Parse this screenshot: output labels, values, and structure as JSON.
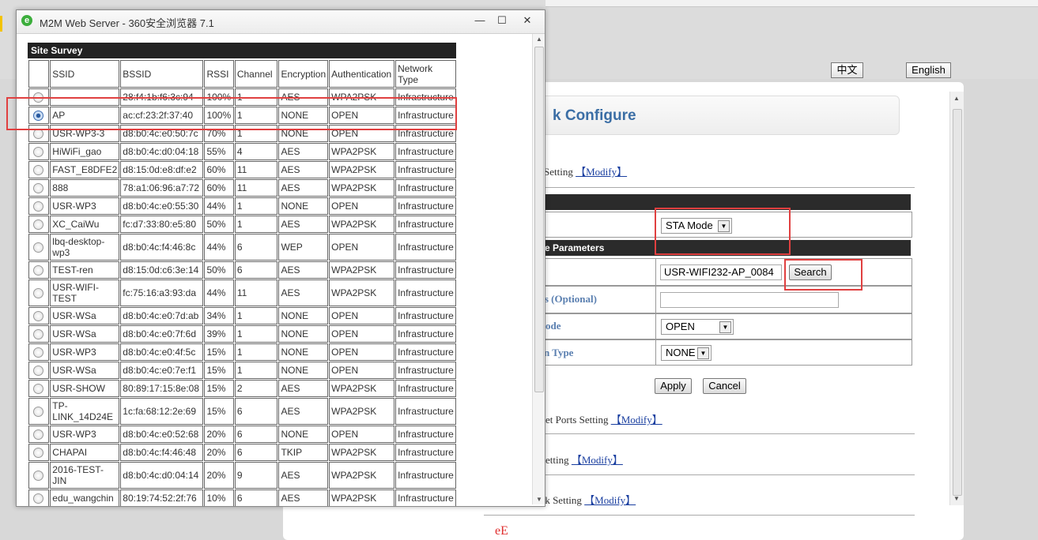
{
  "background_page": {
    "lang_chinese": "中文",
    "lang_english": "English",
    "title": "k Configure",
    "section1_text": "Setting",
    "modify_label": "【Modify】",
    "bar1_label": "",
    "mode_select": "STA Mode",
    "bar2_label": "e Parameters",
    "ssid_value": "USR-WIFI232-AP_0084",
    "search_button": "Search",
    "mac_label": "ess (Optional)",
    "mac_value": "",
    "auth_label": "ode",
    "auth_value": "OPEN",
    "enc_label": "n Type",
    "enc_value": "NONE",
    "apply_button": "Apply",
    "cancel_button": "Cancel",
    "ports_text": "et Ports Setting",
    "setting_text": "etting",
    "network_text": "rk Setting",
    "stray_char": "eE"
  },
  "popup": {
    "window_title": "M2M Web Server - 360安全浏览器 7.1",
    "minimize": "—",
    "maximize": "☐",
    "close": "✕",
    "survey_title": "Site Survey",
    "columns": [
      "",
      "SSID",
      "BSSID",
      "RSSI",
      "Channel",
      "Encryption",
      "Authentication",
      "Network Type"
    ],
    "rows": [
      {
        "selected": false,
        "ssid": "",
        "bssid": "28:f4:1b:f6:3c:94",
        "rssi": "100%",
        "channel": "1",
        "encryption": "AES",
        "auth": "WPA2PSK",
        "type": "Infrastructure"
      },
      {
        "selected": true,
        "ssid": "AP",
        "bssid": "ac:cf:23:2f:37:40",
        "rssi": "100%",
        "channel": "1",
        "encryption": "NONE",
        "auth": "OPEN",
        "type": "Infrastructure"
      },
      {
        "selected": false,
        "ssid": "USR-WP3-3",
        "bssid": "d8:b0:4c:e0:50:7c",
        "rssi": "70%",
        "channel": "1",
        "encryption": "NONE",
        "auth": "OPEN",
        "type": "Infrastructure"
      },
      {
        "selected": false,
        "ssid": "HiWiFi_gao",
        "bssid": "d8:b0:4c:d0:04:18",
        "rssi": "55%",
        "channel": "4",
        "encryption": "AES",
        "auth": "WPA2PSK",
        "type": "Infrastructure"
      },
      {
        "selected": false,
        "ssid": "FAST_E8DFE2",
        "bssid": "d8:15:0d:e8:df:e2",
        "rssi": "60%",
        "channel": "11",
        "encryption": "AES",
        "auth": "WPA2PSK",
        "type": "Infrastructure"
      },
      {
        "selected": false,
        "ssid": "888",
        "bssid": "78:a1:06:96:a7:72",
        "rssi": "60%",
        "channel": "11",
        "encryption": "AES",
        "auth": "WPA2PSK",
        "type": "Infrastructure"
      },
      {
        "selected": false,
        "ssid": "USR-WP3",
        "bssid": "d8:b0:4c:e0:55:30",
        "rssi": "44%",
        "channel": "1",
        "encryption": "NONE",
        "auth": "OPEN",
        "type": "Infrastructure"
      },
      {
        "selected": false,
        "ssid": "XC_CaiWu",
        "bssid": "fc:d7:33:80:e5:80",
        "rssi": "50%",
        "channel": "1",
        "encryption": "AES",
        "auth": "WPA2PSK",
        "type": "Infrastructure"
      },
      {
        "selected": false,
        "ssid": "lbq-desktop-wp3",
        "bssid": "d8:b0:4c:f4:46:8c",
        "rssi": "44%",
        "channel": "6",
        "encryption": "WEP",
        "auth": "OPEN",
        "type": "Infrastructure",
        "tall": true
      },
      {
        "selected": false,
        "ssid": "TEST-ren",
        "bssid": "d8:15:0d:c6:3e:14",
        "rssi": "50%",
        "channel": "6",
        "encryption": "AES",
        "auth": "WPA2PSK",
        "type": "Infrastructure"
      },
      {
        "selected": false,
        "ssid": "USR-WIFI-TEST",
        "bssid": "fc:75:16:a3:93:da",
        "rssi": "44%",
        "channel": "11",
        "encryption": "AES",
        "auth": "WPA2PSK",
        "type": "Infrastructure",
        "tall": true
      },
      {
        "selected": false,
        "ssid": "USR-WSa",
        "bssid": "d8:b0:4c:e0:7d:ab",
        "rssi": "34%",
        "channel": "1",
        "encryption": "NONE",
        "auth": "OPEN",
        "type": "Infrastructure"
      },
      {
        "selected": false,
        "ssid": "USR-WSa",
        "bssid": "d8:b0:4c:e0:7f:6d",
        "rssi": "39%",
        "channel": "1",
        "encryption": "NONE",
        "auth": "OPEN",
        "type": "Infrastructure"
      },
      {
        "selected": false,
        "ssid": "USR-WP3",
        "bssid": "d8:b0:4c:e0:4f:5c",
        "rssi": "15%",
        "channel": "1",
        "encryption": "NONE",
        "auth": "OPEN",
        "type": "Infrastructure"
      },
      {
        "selected": false,
        "ssid": "USR-WSa",
        "bssid": "d8:b0:4c:e0:7e:f1",
        "rssi": "15%",
        "channel": "1",
        "encryption": "NONE",
        "auth": "OPEN",
        "type": "Infrastructure"
      },
      {
        "selected": false,
        "ssid": "USR-SHOW",
        "bssid": "80:89:17:15:8e:08",
        "rssi": "15%",
        "channel": "2",
        "encryption": "AES",
        "auth": "WPA2PSK",
        "type": "Infrastructure"
      },
      {
        "selected": false,
        "ssid": "TP-LINK_14D24E",
        "bssid": "1c:fa:68:12:2e:69",
        "rssi": "15%",
        "channel": "6",
        "encryption": "AES",
        "auth": "WPA2PSK",
        "type": "Infrastructure",
        "tall": true
      },
      {
        "selected": false,
        "ssid": "USR-WP3",
        "bssid": "d8:b0:4c:e0:52:68",
        "rssi": "20%",
        "channel": "6",
        "encryption": "NONE",
        "auth": "OPEN",
        "type": "Infrastructure"
      },
      {
        "selected": false,
        "ssid": "CHAPAI",
        "bssid": "d8:b0:4c:f4:46:48",
        "rssi": "20%",
        "channel": "6",
        "encryption": "TKIP",
        "auth": "WPA2PSK",
        "type": "Infrastructure"
      },
      {
        "selected": false,
        "ssid": "2016-TEST-JIN",
        "bssid": "d8:b0:4c:d0:04:14",
        "rssi": "20%",
        "channel": "9",
        "encryption": "AES",
        "auth": "WPA2PSK",
        "type": "Infrastructure",
        "tall": true
      },
      {
        "selected": false,
        "ssid": "edu_wangchin",
        "bssid": "80:19:74:52:2f:76",
        "rssi": "10%",
        "channel": "6",
        "encryption": "AES",
        "auth": "WPA2PSK",
        "type": "Infrastructure"
      }
    ]
  },
  "colors": {
    "annotation_red": "#e04040",
    "link_blue": "#1a3fa0",
    "title_blue": "#3b6ea5",
    "header_dark": "#222222"
  }
}
